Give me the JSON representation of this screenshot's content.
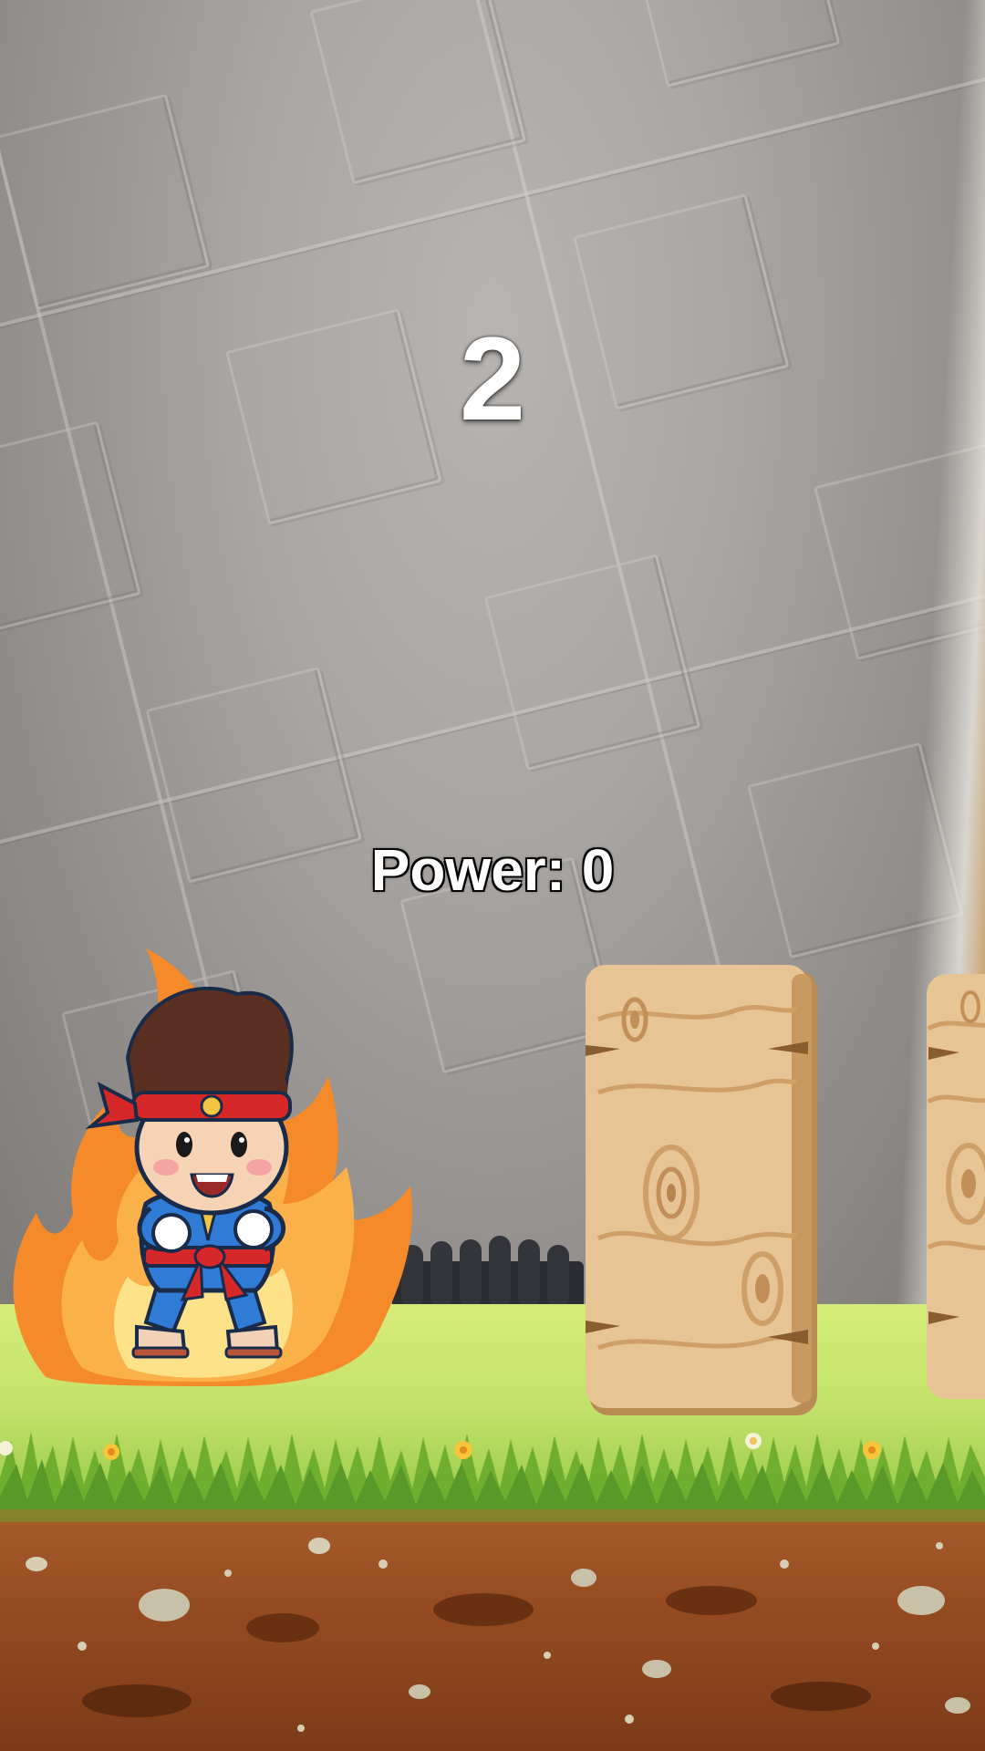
{
  "hud": {
    "score": "2",
    "power_label": "Power: 0",
    "power_value": 0
  },
  "scene": {
    "player": "karate-fighter-powered-up",
    "obstacles": [
      "wooden-plank",
      "wooden-plank"
    ],
    "colors": {
      "grass": "#c4e36a",
      "soil": "#934a20",
      "wood": "#e6c493",
      "fire": "#f58a2a",
      "headband": "#d62828",
      "gi": "#2f7bd6"
    }
  }
}
